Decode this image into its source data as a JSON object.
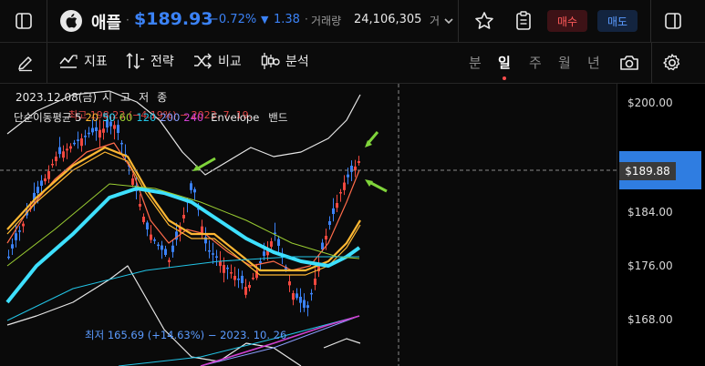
{
  "header": {
    "stock_name": "애플",
    "price": "$189.93",
    "change_pct": "−0.72%",
    "change_abs": "1.38",
    "volume_label": "거래량",
    "volume_value": "24,106,305",
    "volume_trunc": "거",
    "buy_label": "매수",
    "sell_label": "매도"
  },
  "toolbar": {
    "indicators_label": "지표",
    "strategy_label": "전략",
    "compare_label": "비교",
    "analysis_label": "분석",
    "timeframes": [
      "분",
      "일",
      "주",
      "월",
      "년"
    ],
    "active_timeframe": "일"
  },
  "chart": {
    "date_label": "2023.12.08(금)",
    "ohlc_labels": "시고저종",
    "legend_ma_label": "단순이동평균 5",
    "legend_ma_values": [
      "20",
      "50",
      "60",
      "120",
      "200",
      "240"
    ],
    "legend_ma_colors": [
      "#ff6b4a",
      "#ffb833",
      "#3ee0ff",
      "#9acd32",
      "#22c4e6",
      "#8a9eff",
      "#d040d0"
    ],
    "legend_envelope": "Envelope",
    "legend_bands": "밴드",
    "high_annotation": "최고 198.23 (−4.19%) − 2023. 7. 19.",
    "low_annotation": "최저 165.69 (+14.63%) − 2023. 10. 26.",
    "y_ticks": [
      "$200.00",
      "$184.00",
      "$176.00",
      "$168.00"
    ],
    "current_price_tag": "$189.88",
    "up_color": "#f2483f",
    "down_color": "#3b82f6"
  }
}
